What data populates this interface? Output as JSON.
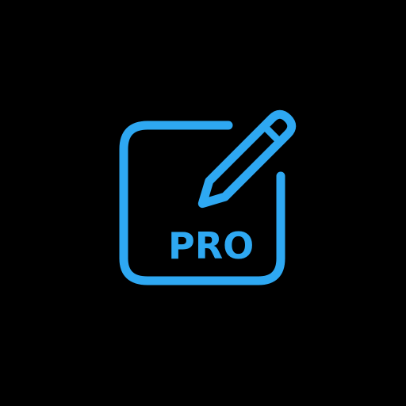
{
  "icon": {
    "name": "edit-pro-icon",
    "badge_text": "PRO",
    "color": "#2EA8F2",
    "background": "#000000"
  }
}
